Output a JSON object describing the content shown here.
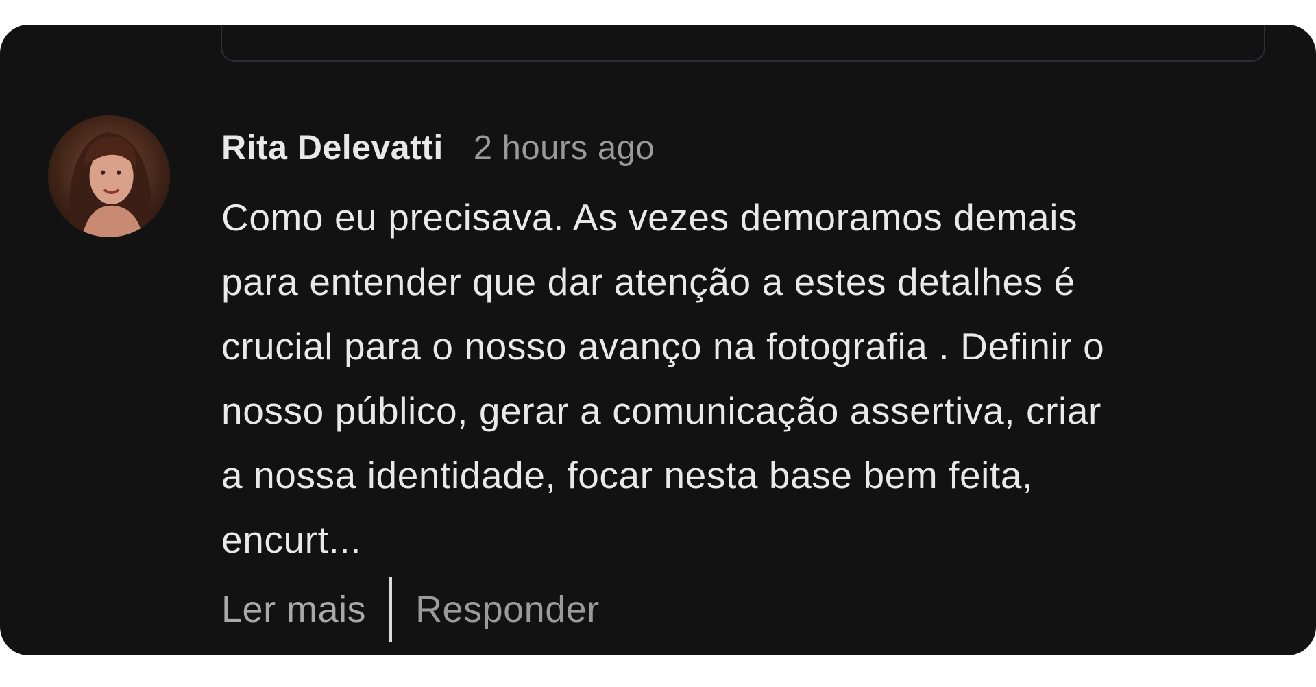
{
  "comment": {
    "author": "Rita Delevatti",
    "timestamp": "2 hours ago",
    "lines": [
      "Como eu precisava. As vezes demoramos demais",
      "para entender que dar atenção a estes detalhes é",
      "crucial para o nosso avanço na fotografia . Definir o",
      "nosso público, gerar a comunicação assertiva, criar",
      "a nossa identidade, focar nesta base bem feita,",
      "encurt..."
    ],
    "avatar_icon": "avatar-photo"
  },
  "actions": {
    "read_more_label": "Ler mais",
    "reply_label": "Responder"
  },
  "colors": {
    "card_background": "#121212",
    "author_text": "#e8e8e8",
    "muted_text": "#9a9a9a"
  }
}
